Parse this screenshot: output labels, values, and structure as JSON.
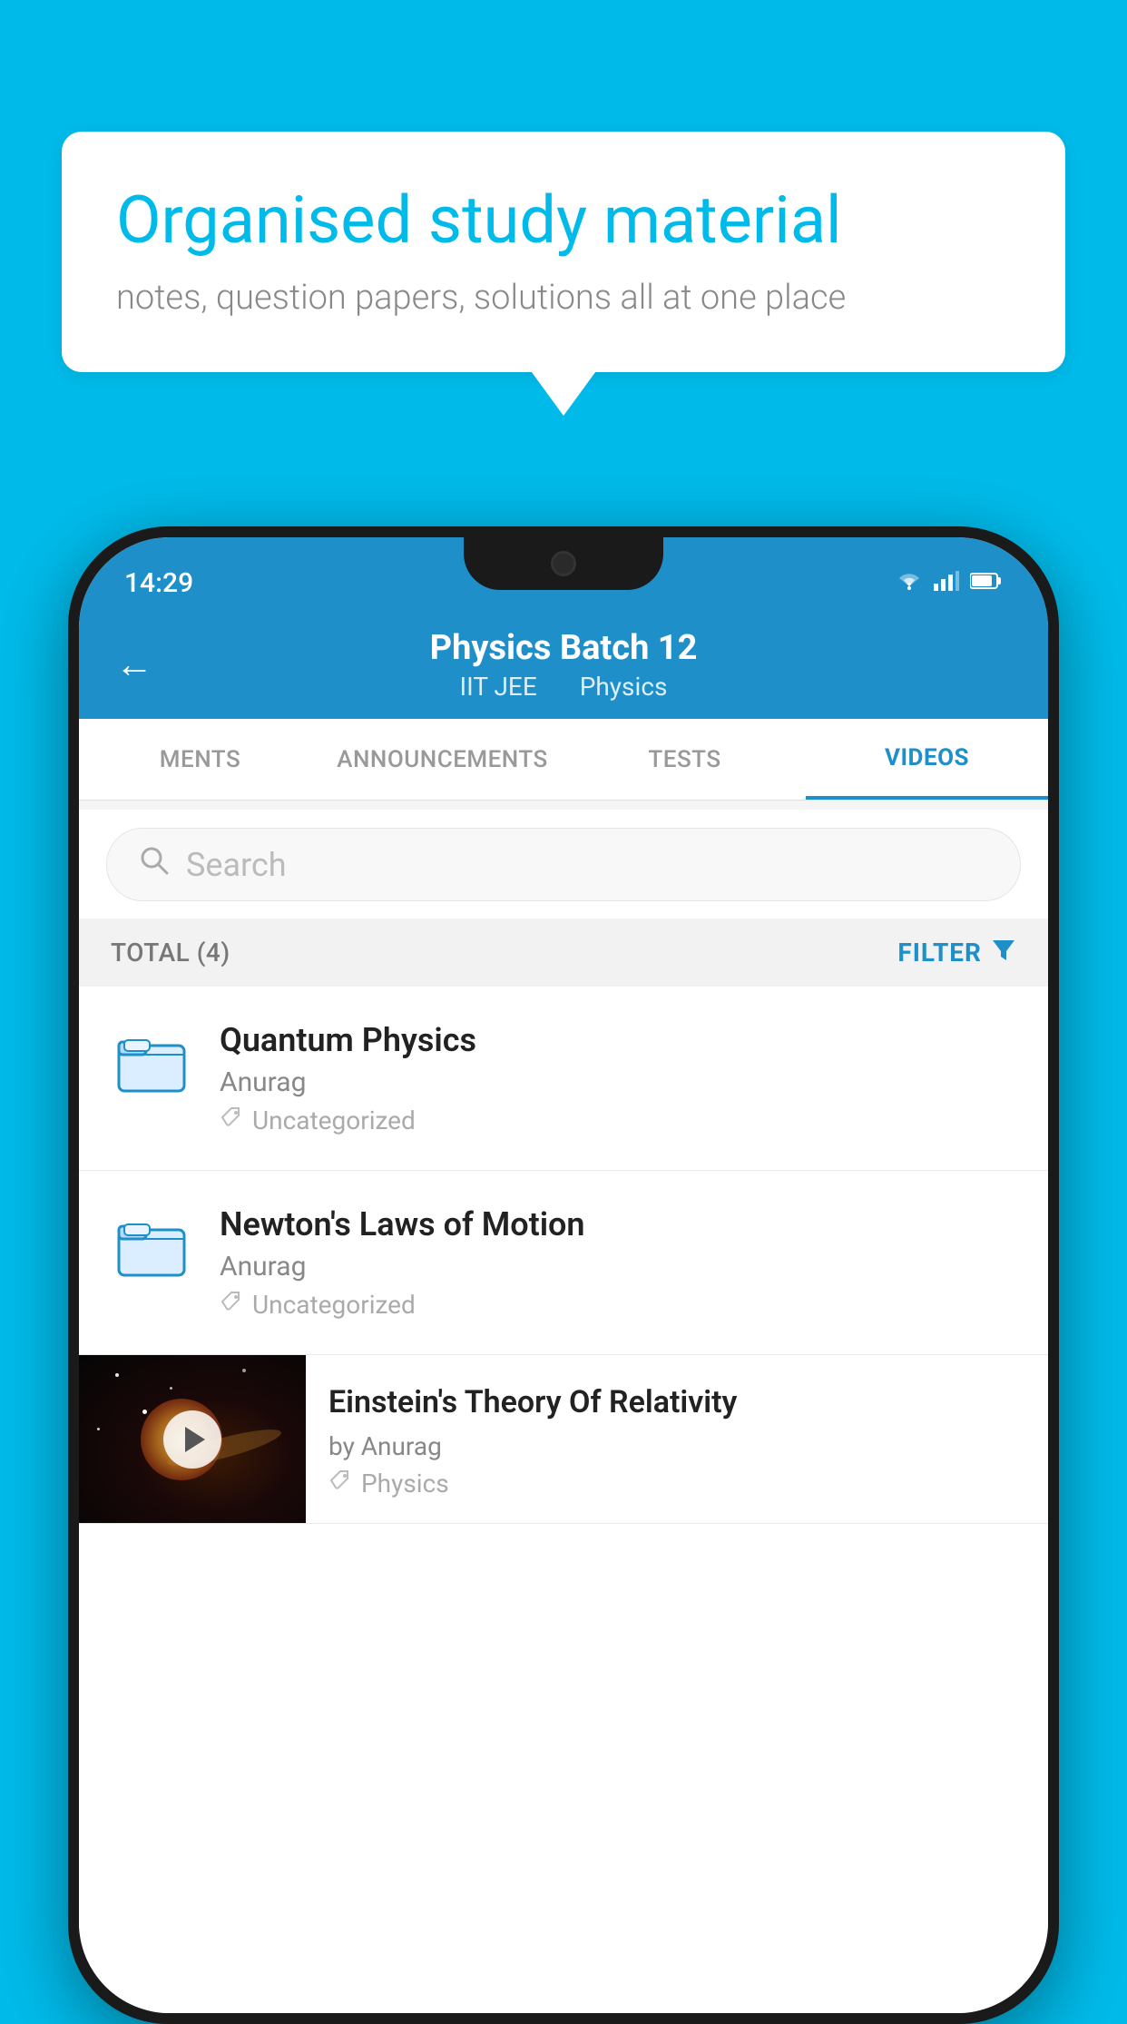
{
  "background_color": "#00BBEA",
  "speech_bubble": {
    "title": "Organised study material",
    "subtitle": "notes, question papers, solutions all at one place"
  },
  "status_bar": {
    "time": "14:29",
    "wifi": "▾",
    "signal": "▴▴",
    "battery": "▮"
  },
  "header": {
    "title": "Physics Batch 12",
    "subtitle1": "IIT JEE",
    "subtitle2": "Physics",
    "back_label": "←"
  },
  "tabs": [
    {
      "label": "MENTS",
      "active": false
    },
    {
      "label": "ANNOUNCEMENTS",
      "active": false
    },
    {
      "label": "TESTS",
      "active": false
    },
    {
      "label": "VIDEOS",
      "active": true
    }
  ],
  "search": {
    "placeholder": "Search"
  },
  "filter_bar": {
    "total_label": "TOTAL (4)",
    "filter_label": "FILTER"
  },
  "video_items": [
    {
      "title": "Quantum Physics",
      "author": "Anurag",
      "tag": "Uncategorized",
      "type": "folder"
    },
    {
      "title": "Newton's Laws of Motion",
      "author": "Anurag",
      "tag": "Uncategorized",
      "type": "folder"
    },
    {
      "title": "Einstein's Theory Of Relativity",
      "author": "by Anurag",
      "tag": "Physics",
      "type": "video"
    }
  ]
}
